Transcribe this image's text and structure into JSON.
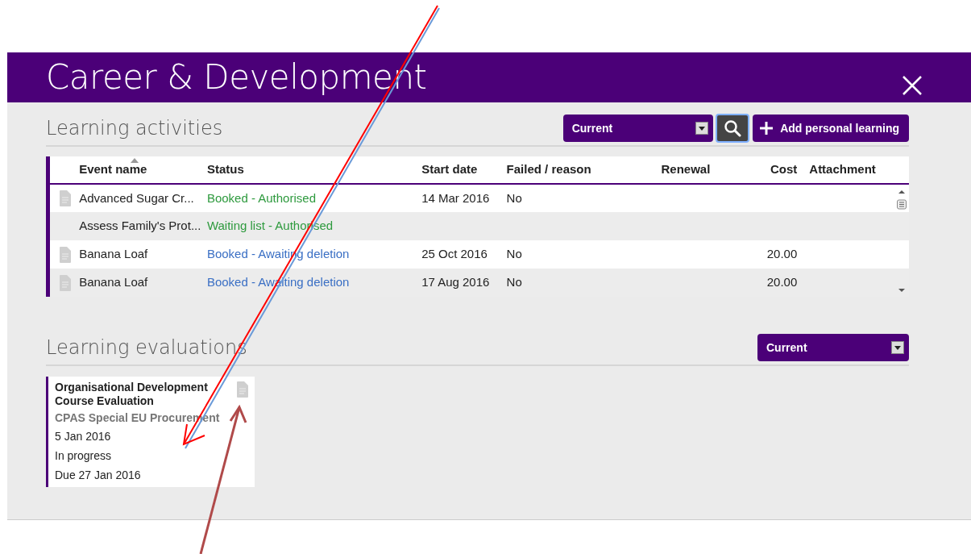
{
  "header": {
    "title": "Career & Development"
  },
  "activities": {
    "title": "Learning activities",
    "filter": {
      "value": "Current"
    },
    "add_button": {
      "label": "Add personal learning"
    },
    "columns": [
      {
        "label": "Event name",
        "sorted": true
      },
      {
        "label": "Status",
        "sorted": false
      },
      {
        "label": "Start date",
        "sorted": false
      },
      {
        "label": "Failed / reason",
        "sorted": false
      },
      {
        "label": "Renewal",
        "sorted": false
      },
      {
        "label": "Cost",
        "sorted": false
      },
      {
        "label": "Attachment",
        "sorted": false
      }
    ],
    "rows": [
      {
        "has_document": true,
        "event": "Advanced Sugar Cr...",
        "status": "Booked - Authorised",
        "color": "#2e9a3e",
        "start": "14 Mar 2016",
        "failed": "No",
        "cost": ""
      },
      {
        "has_document": false,
        "event": "Assess Family's Prot...",
        "status": "Waiting list - Authorised",
        "color": "#2e9a3e",
        "start": "",
        "failed": "",
        "cost": ""
      },
      {
        "has_document": true,
        "event": "Banana Loaf",
        "status": "Booked - Awaiting deletion",
        "color": "#3a6fc4",
        "start": "25 Oct 2016",
        "failed": "No",
        "cost": "20.00"
      },
      {
        "has_document": true,
        "event": "Banana Loaf",
        "status": "Booked - Awaiting deletion",
        "color": "#3a6fc4",
        "start": "17 Aug 2016",
        "failed": "No",
        "cost": "20.00"
      }
    ]
  },
  "evaluations": {
    "title": "Learning evaluations",
    "filter": {
      "value": "Current"
    },
    "cards": [
      {
        "title": "Organisational Development Course Evaluation",
        "course": "CPAS Special EU Procurement",
        "date": "5 Jan 2016",
        "state": "In progress",
        "due": "Due 27 Jan 2016",
        "has_document": true
      }
    ]
  },
  "annotations": [
    {
      "kind": "arrow",
      "color": "#ff0000"
    },
    {
      "kind": "arrow",
      "color": "#b04a4a"
    }
  ]
}
